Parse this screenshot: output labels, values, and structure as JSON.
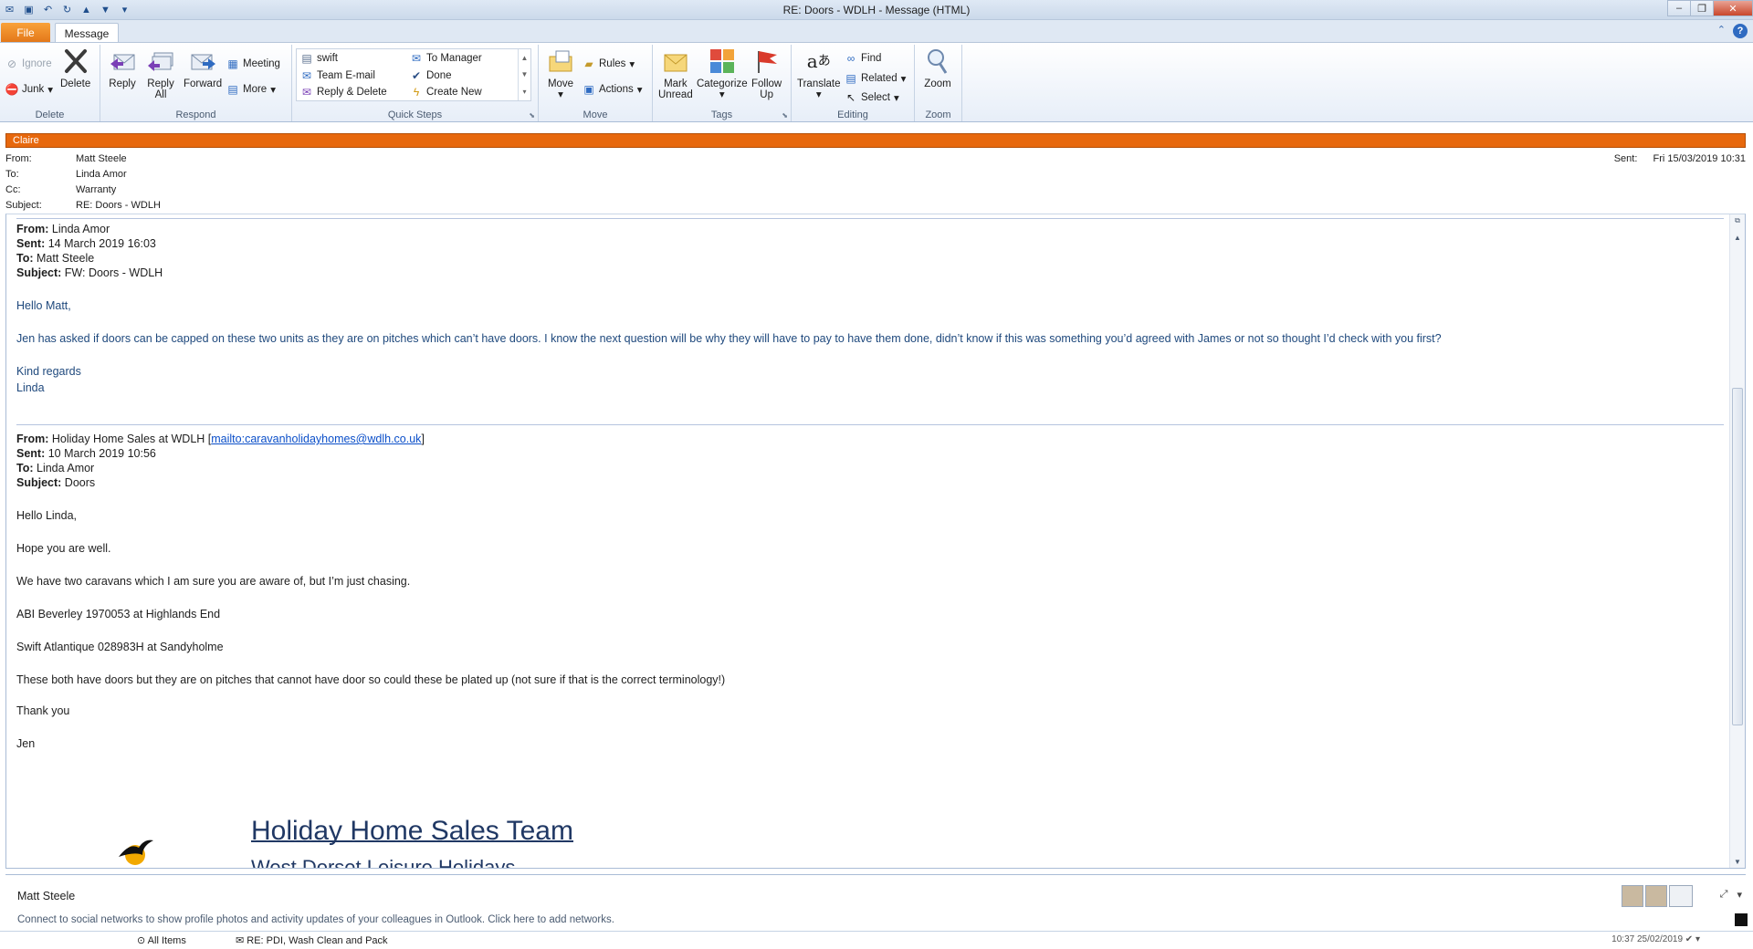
{
  "window": {
    "title": "RE: Doors - WDLH  -  Message (HTML)"
  },
  "tabs": {
    "file": "File",
    "message": "Message"
  },
  "ribbon": {
    "delete": {
      "ignore": "Ignore",
      "junk": "Junk",
      "delete": "Delete",
      "group": "Delete"
    },
    "respond": {
      "reply": "Reply",
      "reply_all_1": "Reply",
      "reply_all_2": "All",
      "forward": "Forward",
      "meeting": "Meeting",
      "more": "More",
      "group": "Respond"
    },
    "quick_steps": {
      "items": [
        "swift",
        "To Manager",
        "Team E-mail",
        "Done",
        "Reply & Delete",
        "Create New"
      ],
      "group": "Quick Steps"
    },
    "move": {
      "move": "Move",
      "rules": "Rules",
      "actions": "Actions",
      "group": "Move"
    },
    "tags": {
      "mark_unread_1": "Mark",
      "mark_unread_2": "Unread",
      "categorize": "Categorize",
      "follow_up_1": "Follow",
      "follow_up_2": "Up",
      "group": "Tags"
    },
    "editing": {
      "translate": "Translate",
      "find": "Find",
      "related": "Related",
      "select": "Select",
      "group": "Editing"
    },
    "zoom": {
      "zoom": "Zoom",
      "group": "Zoom"
    }
  },
  "header": {
    "category": "Claire",
    "from_label": "From:",
    "from": "Matt Steele",
    "to_label": "To:",
    "to": "Linda Amor",
    "cc_label": "Cc:",
    "cc": "Warranty",
    "subject_label": "Subject:",
    "subject": "RE: Doors - WDLH",
    "sent_label": "Sent:",
    "sent": "Fri 15/03/2019 10:31"
  },
  "message1": {
    "from_label": "From:",
    "from": " Linda Amor",
    "sent_label": "Sent:",
    "sent": " 14 March 2019 16:03",
    "to_label": "To:",
    "to": " Matt Steele",
    "subject_label": "Subject:",
    "subject": " FW: Doors - WDLH",
    "greeting": "Hello Matt,",
    "body": "Jen has asked if doors can be capped on these two units as they are on pitches which can’t have doors.  I know the next question will be why they will have to pay to have them done, didn’t know if this was something you’d agreed with James or not so thought I’d check with you first?",
    "closing": "Kind regards",
    "signature": "Linda"
  },
  "message2": {
    "from_label": "From:",
    "from": " Holiday Home Sales at WDLH [",
    "from_link": "mailto:caravanholidayhomes@wdlh.co.uk",
    "from_close": "]",
    "sent_label": "Sent:",
    "sent": " 10 March 2019 10:56",
    "to_label": "To:",
    "to": " Linda Amor",
    "subject_label": "Subject:",
    "subject": " Doors",
    "greeting": "Hello Linda,",
    "line1": "Hope you are well.",
    "line2": "We have two caravans which I am sure you are aware of, but I’m just chasing.",
    "line3": "ABI Beverley 1970053 at Highlands End",
    "line4": "Swift Atlantique 028983H at Sandyholme",
    "line5": "These both have doors but they are on pitches that cannot have door so could these be plated up (not sure if that is the correct terminology!)",
    "line6": "Thank you",
    "sign": "Jen",
    "sig_title": "Holiday Home Sales Team",
    "sig_sub": "West Dorset Leisure Holidays"
  },
  "people_pane": {
    "name": "Matt Steele",
    "text": "Connect to social networks to show profile photos and activity updates of your colleagues in Outlook. Click here to add networks."
  },
  "status": {
    "all_items": "All Items",
    "item": "RE: PDI, Wash Clean and Pack",
    "time": "10:37  25/02/2019"
  },
  "colors": {
    "category": "#e7680d",
    "file_tab": "#e3781a",
    "quoted_text": "#1f497d",
    "link": "#0b4fc9"
  }
}
